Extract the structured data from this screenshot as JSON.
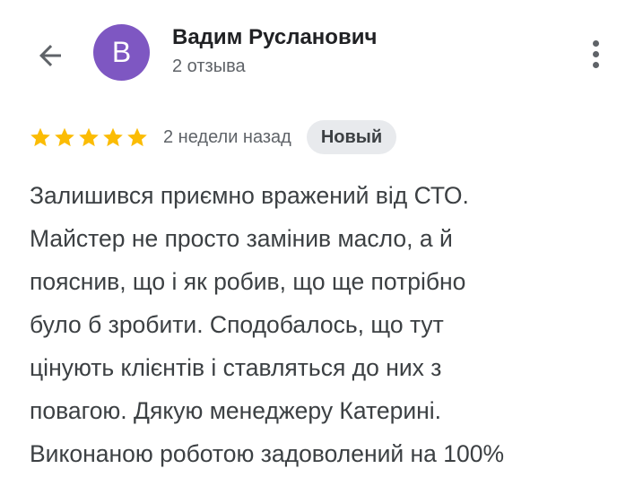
{
  "header": {
    "back_icon": "arrow-back-icon",
    "author": {
      "avatar_letter": "В",
      "avatar_color": "#7e57c2",
      "name": "Вадим Русланович",
      "reviews_count": "2 отзыва"
    },
    "menu_icon": "more-vert-icon"
  },
  "review": {
    "rating": 5,
    "rating_max": 5,
    "star_color": "#fbbc04",
    "date": "2 недели назад",
    "badge": "Новый",
    "text_lines": [
      "Залишився приємно вражений від СТО.",
      "Майстер не просто замінив масло, а й",
      "пояснив, що і як робив, що ще потрібно",
      "було б зробити. Сподобалось, що тут",
      "цінують клієнтів і ставляться до них з",
      "повагою. Дякую менеджеру Катерині.",
      "Виконаною роботою задоволений на 100%"
    ]
  }
}
